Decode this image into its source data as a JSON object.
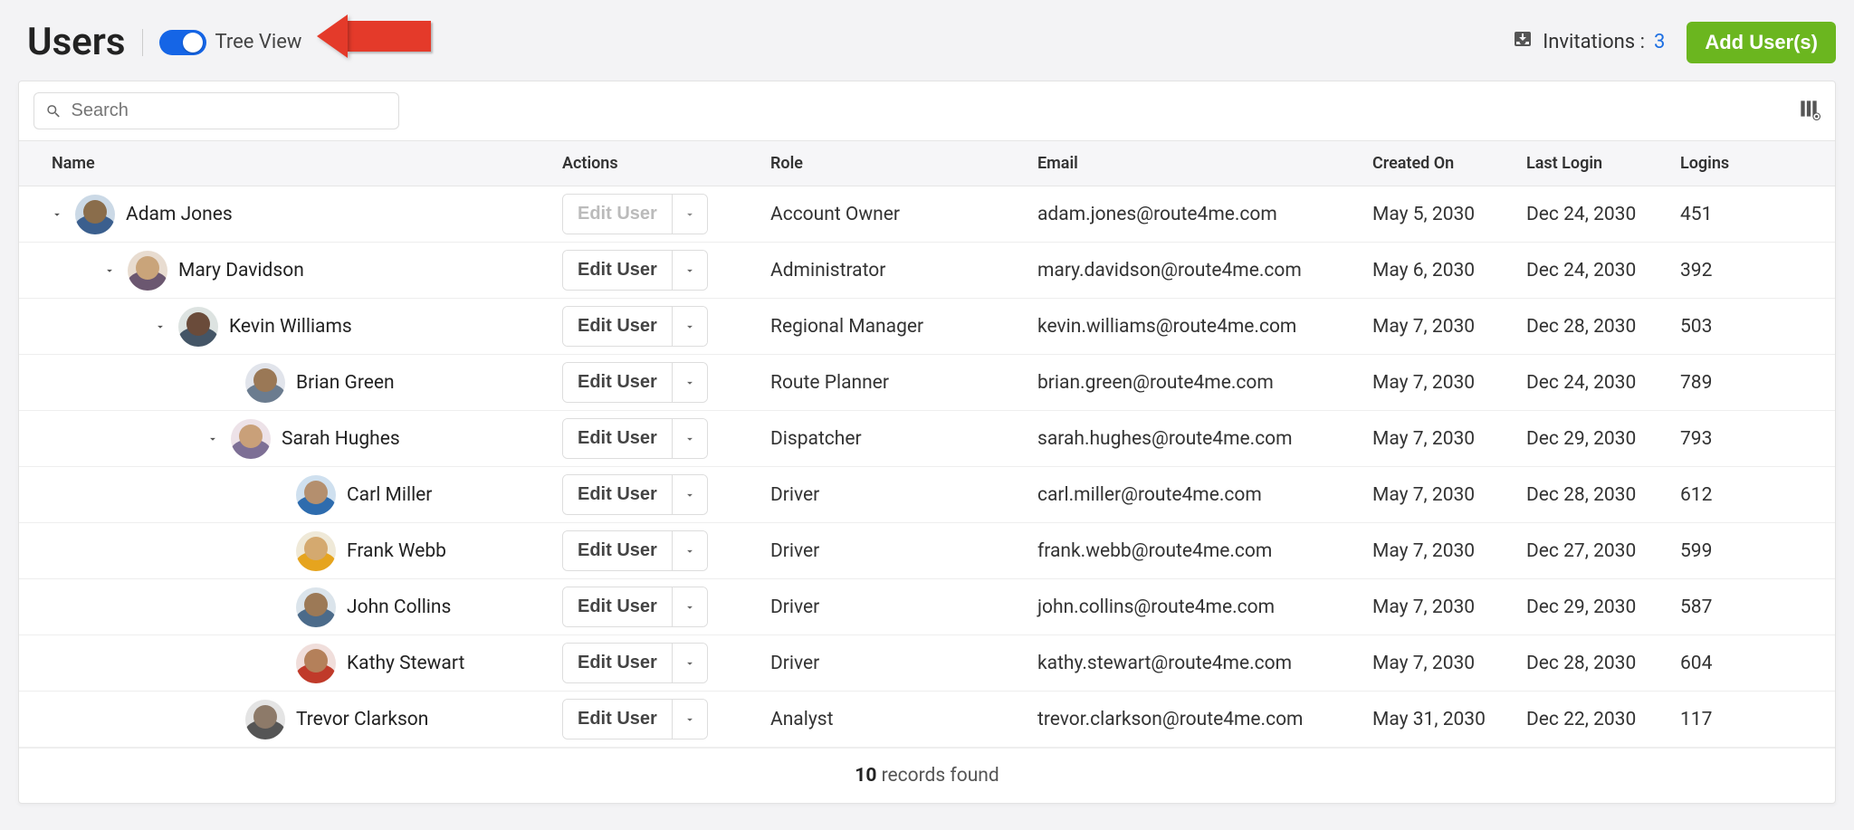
{
  "colors": {
    "accent": "#1565e6",
    "add": "#6bb61f",
    "arrow": "#e43a2a"
  },
  "header": {
    "title": "Users",
    "toggle_label": "Tree View",
    "invitations_label": "Invitations :",
    "invitations_count": "3",
    "add_button": "Add User(s)"
  },
  "search": {
    "placeholder": "Search"
  },
  "columns": {
    "name": "Name",
    "actions": "Actions",
    "role": "Role",
    "email": "Email",
    "created": "Created On",
    "last_login": "Last Login",
    "logins": "Logins"
  },
  "actions": {
    "edit": "Edit User"
  },
  "users": [
    {
      "name": "Adam Jones",
      "role": "Account Owner",
      "email": "adam.jones@route4me.com",
      "created": "May 5, 2030",
      "last_login": "Dec 24, 2030",
      "logins": "451"
    },
    {
      "name": "Mary Davidson",
      "role": "Administrator",
      "email": "mary.davidson@route4me.com",
      "created": "May 6, 2030",
      "last_login": "Dec 24, 2030",
      "logins": "392"
    },
    {
      "name": "Kevin Williams",
      "role": "Regional Manager",
      "email": "kevin.williams@route4me.com",
      "created": "May 7, 2030",
      "last_login": "Dec 28, 2030",
      "logins": "503"
    },
    {
      "name": "Brian Green",
      "role": "Route Planner",
      "email": "brian.green@route4me.com",
      "created": "May 7, 2030",
      "last_login": "Dec 24, 2030",
      "logins": "789"
    },
    {
      "name": "Sarah Hughes",
      "role": "Dispatcher",
      "email": "sarah.hughes@route4me.com",
      "created": "May 7, 2030",
      "last_login": "Dec 29, 2030",
      "logins": "793"
    },
    {
      "name": "Carl Miller",
      "role": "Driver",
      "email": "carl.miller@route4me.com",
      "created": "May 7, 2030",
      "last_login": "Dec 28, 2030",
      "logins": "612"
    },
    {
      "name": "Frank Webb",
      "role": "Driver",
      "email": "frank.webb@route4me.com",
      "created": "May 7, 2030",
      "last_login": "Dec 27, 2030",
      "logins": "599"
    },
    {
      "name": "John Collins",
      "role": "Driver",
      "email": "john.collins@route4me.com",
      "created": "May 7, 2030",
      "last_login": "Dec 29, 2030",
      "logins": "587"
    },
    {
      "name": "Kathy Stewart",
      "role": "Driver",
      "email": "kathy.stewart@route4me.com",
      "created": "May 7, 2030",
      "last_login": "Dec 28, 2030",
      "logins": "604"
    },
    {
      "name": "Trevor Clarkson",
      "role": "Analyst",
      "email": "trevor.clarkson@route4me.com",
      "created": "May 31, 2030",
      "last_login": "Dec 22, 2030",
      "logins": "117"
    }
  ],
  "footer": {
    "count": "10",
    "text": "records found"
  }
}
